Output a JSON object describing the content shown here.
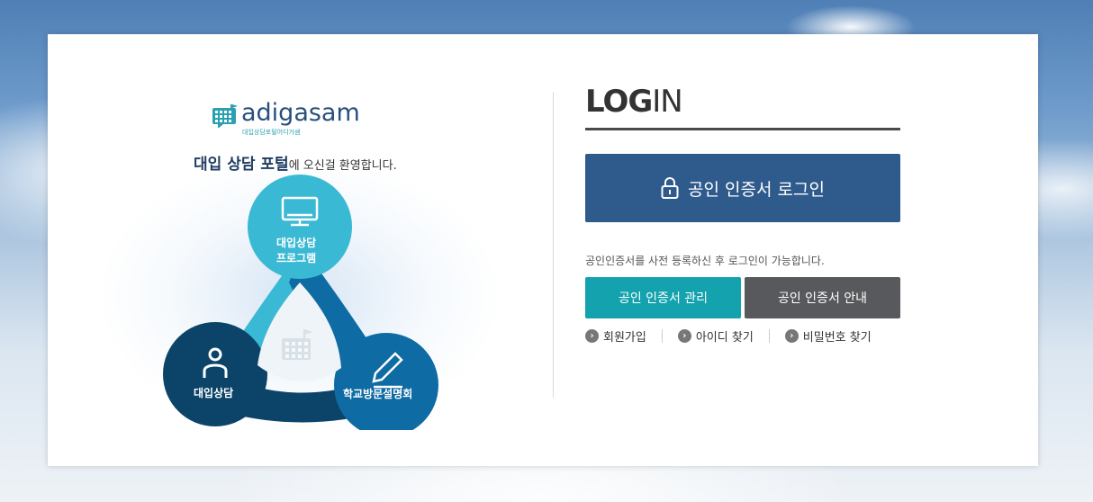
{
  "brand": {
    "logo_text": "adigasam",
    "logo_sub": "대입상담포털어디가샘",
    "welcome_bold": "대입 상담 포털",
    "welcome_rest": "에 오신걸 환영합니다."
  },
  "trefoil": {
    "top_label_1": "대입상담",
    "top_label_2": "프로그램",
    "left_label": "대입상담",
    "right_label": "학교방문설명회"
  },
  "login": {
    "title_bold": "LOG",
    "title_light": "IN",
    "cert_login_label": "공인 인증서 로그인",
    "notice": "공인인증서를 사전 등록하신 후 로그인이 가능합니다.",
    "manage_label": "공인 인증서 관리",
    "guide_label": "공인 인증서 안내",
    "links": [
      "회원가입",
      "아이디 찾기",
      "비밀번호 찾기"
    ]
  },
  "colors": {
    "primary": "#2f5a8c",
    "teal": "#14a3ae",
    "gray_button": "#57595c",
    "trefoil_light": "#3ab9d4",
    "trefoil_mid": "#0e6ba3",
    "trefoil_dark": "#0b4468"
  }
}
